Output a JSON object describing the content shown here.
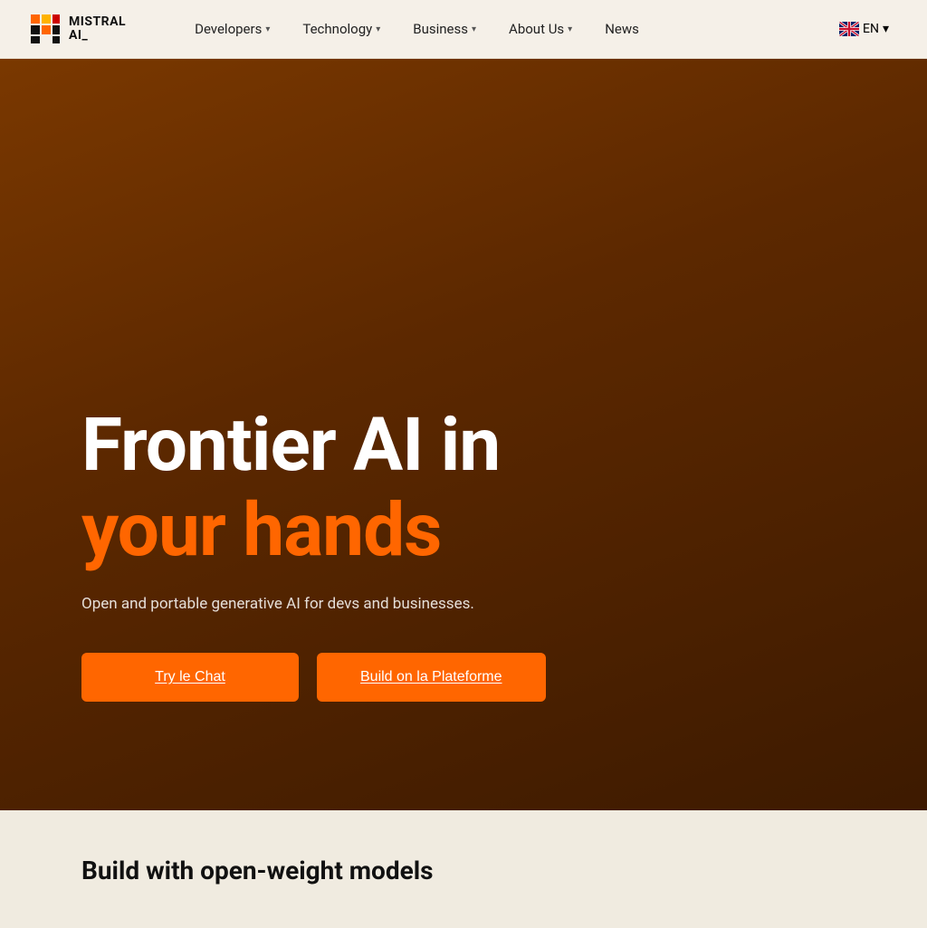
{
  "navbar": {
    "logo_text_line1": "MISTRAL",
    "logo_text_line2": "AI_",
    "nav_items": [
      {
        "label": "Developers",
        "has_dropdown": true
      },
      {
        "label": "Technology",
        "has_dropdown": true
      },
      {
        "label": "Business",
        "has_dropdown": true
      },
      {
        "label": "About Us",
        "has_dropdown": true
      },
      {
        "label": "News",
        "has_dropdown": false
      }
    ],
    "lang_label": "EN"
  },
  "hero": {
    "headline_white": "Frontier AI in",
    "headline_orange": "your hands",
    "subtext": "Open and portable generative AI for devs and businesses.",
    "btn_primary_label": "Try le Chat",
    "btn_secondary_label": "Build on la Plateforme"
  },
  "bottom": {
    "title": "Build with open-weight models"
  },
  "colors": {
    "orange": "#ff6600",
    "hero_bg_start": "#7a3800",
    "hero_bg_end": "#3d1a00",
    "navbar_bg": "#f5f0e8",
    "bottom_bg": "#f0ebe0"
  }
}
